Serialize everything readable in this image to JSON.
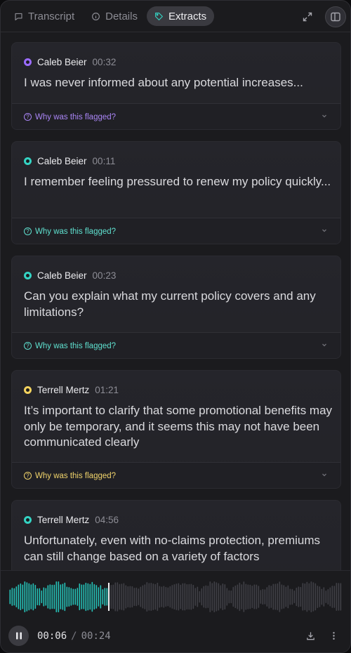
{
  "tabs": [
    {
      "label": "Transcript",
      "icon": "chat-icon",
      "active": false
    },
    {
      "label": "Details",
      "icon": "info-icon",
      "active": false
    },
    {
      "label": "Extracts",
      "icon": "tag-icon",
      "active": true
    }
  ],
  "flag_label": "Why was this flagged?",
  "colors": {
    "purple": "#9b6cff",
    "teal": "#34d3c3",
    "yellow": "#f4d35e"
  },
  "extracts": [
    {
      "speaker": "Caleb Beier",
      "time": "00:32",
      "color": "#9b6cff",
      "flag_color": "#a985f5",
      "text": "I was never informed about any potential increases..."
    },
    {
      "speaker": "Caleb Beier",
      "time": "00:11",
      "color": "#34d3c3",
      "flag_color": "#5fe0cf",
      "text": "I remember feeling pressured to renew my policy quickly..."
    },
    {
      "speaker": "Caleb Beier",
      "time": "00:23",
      "color": "#34d3c3",
      "flag_color": "#5fe0cf",
      "text": "Can you explain what my current policy covers and any limitations?"
    },
    {
      "speaker": "Terrell Mertz",
      "time": "01:21",
      "color": "#f4d35e",
      "flag_color": "#f0d36b",
      "text": "It’s important to clarify that some promotional benefits may only be temporary, and it seems this may not have been communicated clearly"
    },
    {
      "speaker": "Terrell Mertz",
      "time": "04:56",
      "color": "#34d3c3",
      "flag_color": "#5fe0cf",
      "text": "Unfortunately, even with no-claims protection, premiums can still change based on a variety of factors"
    }
  ],
  "player": {
    "current": "00:06",
    "separator": "/",
    "total": "00:24",
    "progress": 0.25,
    "played_color": "#25c0b6",
    "unplayed_color": "#3f3f45"
  }
}
